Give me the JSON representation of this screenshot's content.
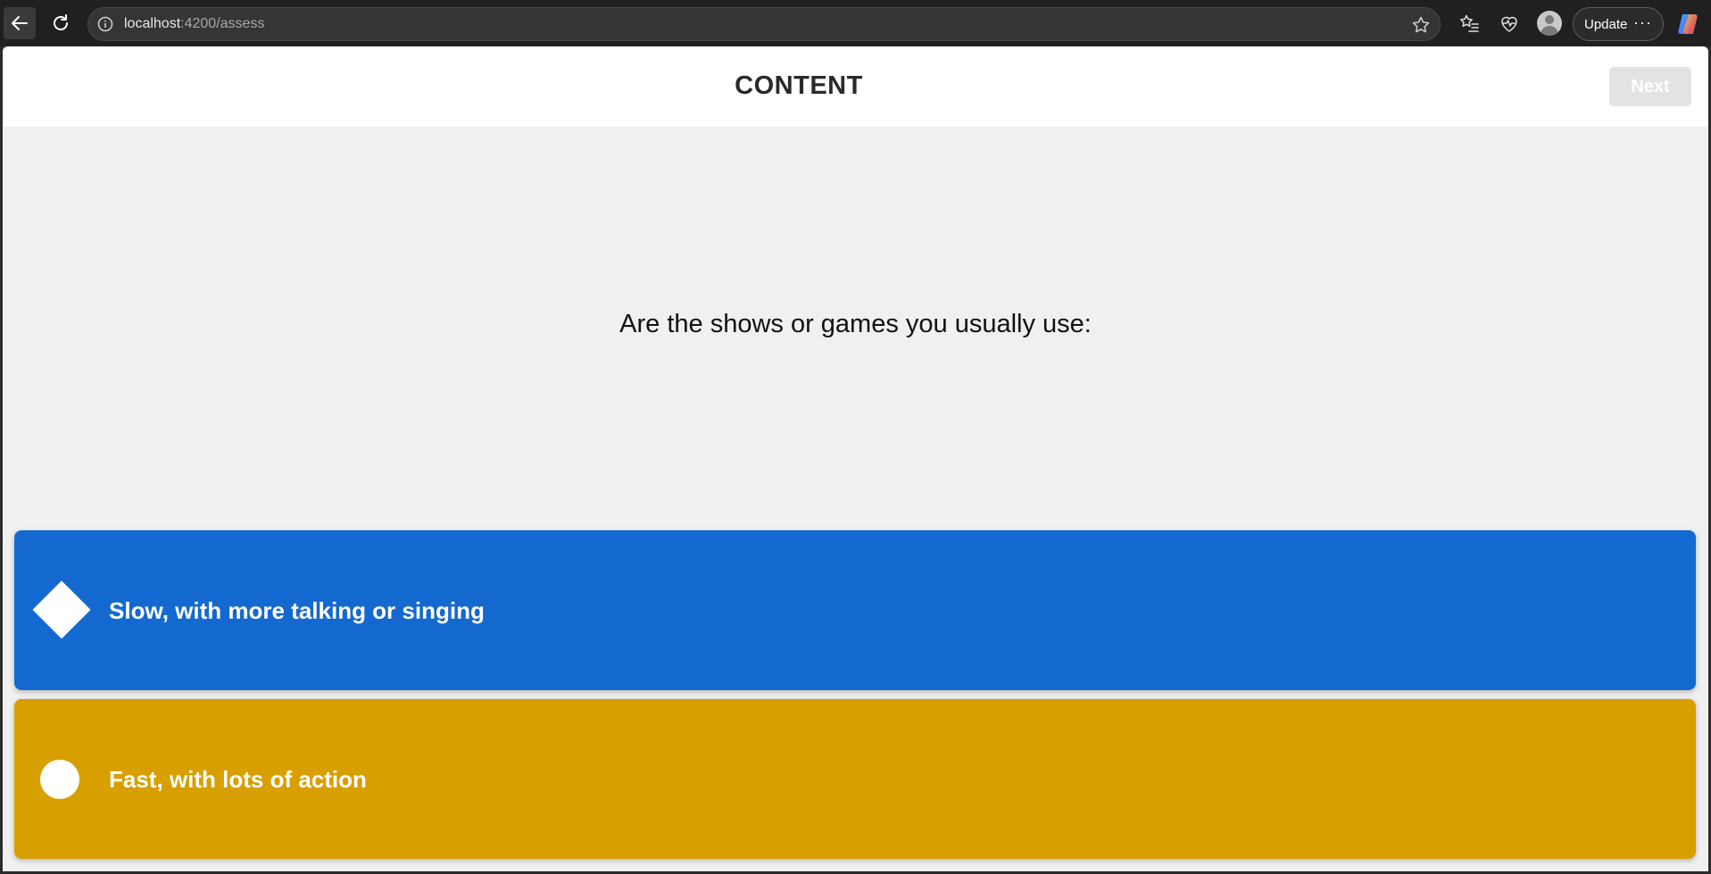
{
  "browser": {
    "url_host": "localhost",
    "url_rest": ":4200/assess",
    "update_label": "Update",
    "more_label": "···"
  },
  "header": {
    "title": "CONTENT",
    "next_label": "Next"
  },
  "question": {
    "text": "Are the shows or games you usually use:"
  },
  "answers": [
    {
      "label": "Slow, with more talking or singing",
      "color": "#1469d0",
      "shape": "diamond"
    },
    {
      "label": "Fast, with lots of action",
      "color": "#d89f00",
      "shape": "circle"
    }
  ]
}
